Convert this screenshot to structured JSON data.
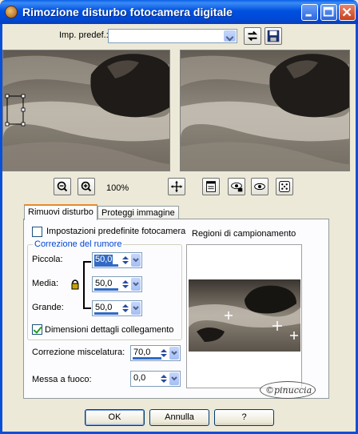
{
  "window": {
    "title": "Rimozione disturbo fotocamera digitale",
    "controls": [
      "minimize",
      "maximize",
      "close"
    ]
  },
  "presets": {
    "label": "Imp. predef.:",
    "value": ""
  },
  "zoom": {
    "level": "100%"
  },
  "tabs": [
    {
      "label": "Rimuovi disturbo",
      "active": true
    },
    {
      "label": "Proteggi immagine",
      "active": false
    }
  ],
  "camera_defaults": {
    "label": "Impostazioni predefinite fotocamera",
    "checked": false
  },
  "noise_correction": {
    "title": "Correzione del rumore",
    "small": {
      "label": "Piccola:",
      "value": "50,0"
    },
    "medium": {
      "label": "Media:",
      "value": "50,0"
    },
    "large": {
      "label": "Grande:",
      "value": "50,0"
    }
  },
  "link_details": {
    "label": "Dimensioni dettagli collegamento",
    "checked": true
  },
  "blend_correction": {
    "label": "Correzione miscelatura:",
    "value": "70,0"
  },
  "sharpen": {
    "label": "Messa a fuoco:",
    "value": "0,0"
  },
  "sampling": {
    "label": "Regioni di campionamento"
  },
  "watermark": {
    "text": "©pinuccia"
  },
  "buttons": {
    "ok": "OK",
    "cancel": "Annulla",
    "help": "?"
  },
  "colors": {
    "title_bar": "#0054e3",
    "window_bg": "#ece9d8",
    "group_title": "#0046d5",
    "selection": "#316ac5",
    "active_tab": "#e68b2c"
  }
}
